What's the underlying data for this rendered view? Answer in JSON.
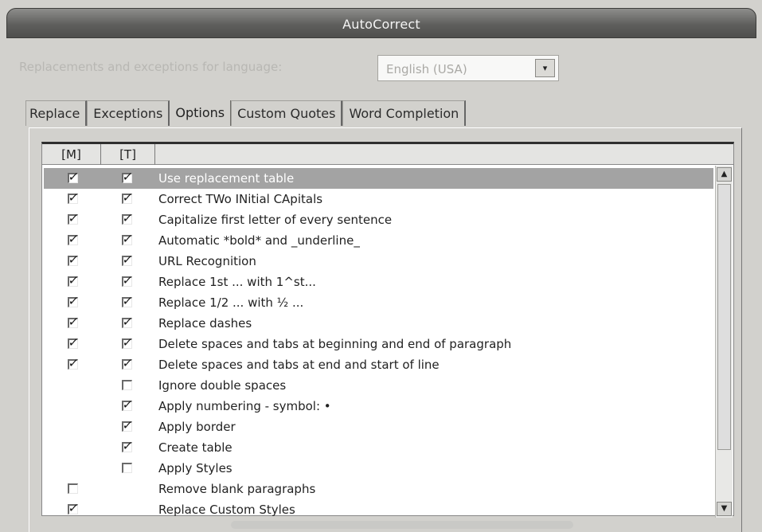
{
  "window": {
    "title": "AutoCorrect"
  },
  "language": {
    "label": "Replacements and exceptions for language:",
    "selected": "English (USA)"
  },
  "tabs": [
    "Replace",
    "Exceptions",
    "Options",
    "Custom Quotes",
    "Word Completion"
  ],
  "grid": {
    "columns": [
      "[M]",
      "[T]",
      ""
    ],
    "rows": [
      {
        "label": "Use replacement table",
        "m": true,
        "t": true,
        "selected": true
      },
      {
        "label": "Correct TWo INitial CApitals",
        "m": true,
        "t": true
      },
      {
        "label": "Capitalize first letter of every sentence",
        "m": true,
        "t": true
      },
      {
        "label": "Automatic *bold* and _underline_",
        "m": true,
        "t": true
      },
      {
        "label": "URL Recognition",
        "m": true,
        "t": true
      },
      {
        "label": "Replace 1st ... with 1^st...",
        "m": true,
        "t": true
      },
      {
        "label": "Replace 1/2 ... with ½ ...",
        "m": true,
        "t": true
      },
      {
        "label": "Replace dashes",
        "m": true,
        "t": true
      },
      {
        "label": "Delete spaces and tabs at beginning and end of paragraph",
        "m": true,
        "t": true
      },
      {
        "label": "Delete spaces and tabs at end and start of line",
        "m": true,
        "t": true
      },
      {
        "label": "Ignore double spaces",
        "m": null,
        "t": false
      },
      {
        "label": "Apply numbering - symbol: •",
        "m": null,
        "t": true
      },
      {
        "label": "Apply border",
        "m": null,
        "t": true
      },
      {
        "label": "Create table",
        "m": null,
        "t": true
      },
      {
        "label": "Apply Styles",
        "m": null,
        "t": false
      },
      {
        "label": "Remove blank paragraphs",
        "m": false,
        "t": null
      },
      {
        "label": "Replace Custom Styles",
        "m": true,
        "t": null
      }
    ]
  },
  "icons": {
    "dropdown": "chevron-down-icon",
    "scroll_up": "scroll-up-icon",
    "scroll_down": "scroll-down-icon",
    "checkbox": "checkmark-icon"
  },
  "colors": {
    "selected_row": "#a3a3a3",
    "window_bg": "#d2d1cd"
  }
}
